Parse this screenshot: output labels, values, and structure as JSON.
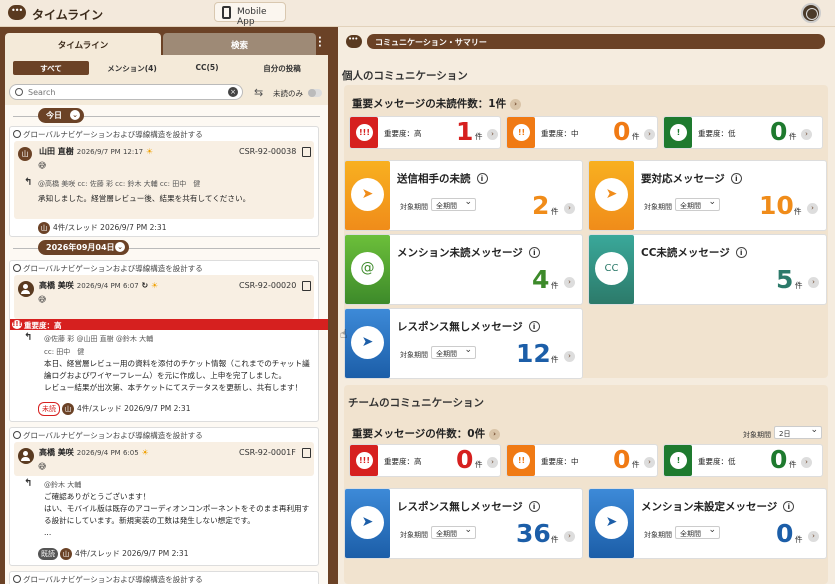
{
  "app": {
    "title": "タイムライン",
    "mobile_label": "Mobile App"
  },
  "left": {
    "tabs": [
      "タイムライン",
      "検索"
    ],
    "filters": [
      "すべて",
      "メンション(4)",
      "CC(5)",
      "自分の投稿"
    ],
    "search_placeholder": "Search",
    "unread_only": "未読のみ",
    "date1": "今日",
    "date2": "2026年09月04日",
    "threads": [
      {
        "title": "グローバルナビゲーションおよび導線構造を設計する",
        "sender": "山田 直樹",
        "avatar": "山",
        "time": "2026/9/7 PM 12:17",
        "code": "CSR-92-00038",
        "to": "@高橋 美咲  cc: 佐藤 彩  cc: 鈴木 大輔  cc: 田中　健",
        "body": "承知しました。経営層レビュー後、結果を共有してください。",
        "footer": "4件/スレッド 2026/9/7 PM 2:31"
      },
      {
        "title": "グローバルナビゲーションおよび導線構造を設計する",
        "sender": "高橋 美咲",
        "time": "2026/9/4 PM 6:07",
        "code": "CSR-92-00020",
        "priority": "重要度：高",
        "to": "@佐藤 彩  @山田 直樹  @鈴木 大輔",
        "cc": "cc: 田中　健",
        "body": "本日、経営層レビュー用の資料を添付のチケット情報（これまでのチャット議\n論ログおよびワイヤーフレーム）を元に作成し、上申を完了しました。\nレビュー結果が出次第、本チケットにてステータスを更新し、共有します！",
        "badge": "未読",
        "footer": "4件/スレッド 2026/9/7 PM 2:31"
      },
      {
        "title": "グローバルナビゲーションおよび導線構造を設計する",
        "sender": "高橋 美咲",
        "time": "2026/9/4 PM 6:05",
        "code": "CSR-92-0001F",
        "to": "@鈴木 大輔",
        "body": "ご確認ありがとうございます！\nはい、モバイル版は既存のアコーディオンコンポーネントをそのまま再利用す\nる設計にしています。新規実装の工数は発生しない想定です。\n...",
        "badge": "既読",
        "footer": "4件/スレッド 2026/9/7 PM 2:31"
      },
      {
        "title": "グローバルナビゲーションおよび導線構造を設計する"
      }
    ]
  },
  "right": {
    "header": "コミュニケーション・サマリー",
    "personal": {
      "title": "個人のコミュニケーション",
      "important_title": "重要メッセージの未読件数：1件",
      "prio": [
        {
          "label": "重要度：高",
          "value": "1",
          "color": "#d6201f",
          "icon": "!!!"
        },
        {
          "label": "重要度：中",
          "value": "0",
          "color": "#f07a14",
          "icon": "!!"
        },
        {
          "label": "重要度：低",
          "value": "0",
          "color": "#1e7a2e",
          "icon": "!"
        }
      ],
      "cards": [
        {
          "title": "送信相手の未読",
          "period_label": "対象期間",
          "period": "全期間",
          "value": "2",
          "color": "#f08c1a",
          "icon": "send-at-icon"
        },
        {
          "title": "要対応メッセージ",
          "period_label": "対象期間",
          "period": "全期間",
          "value": "10",
          "color": "#f08c1a",
          "icon": "send-at-icon"
        },
        {
          "title": "メンション未読メッセージ",
          "value": "4",
          "color": "#3d8a2a",
          "icon": "mention-icon"
        },
        {
          "title": "CC未読メッセージ",
          "value": "5",
          "color": "#2c7a6a",
          "icon": "cc-icon"
        },
        {
          "title": "レスポンス無しメッセージ",
          "period_label": "対象期間",
          "period": "全期間",
          "value": "12",
          "color": "#1c5ea8",
          "icon": "send-icon"
        }
      ]
    },
    "team": {
      "title": "チームのコミュニケーション",
      "important_title": "重要メッセージの件数：0件",
      "period_label": "対象期間",
      "period": "2日",
      "prio": [
        {
          "label": "重要度：高",
          "value": "0",
          "color": "#d6201f",
          "icon": "!!!"
        },
        {
          "label": "重要度：中",
          "value": "0",
          "color": "#f07a14",
          "icon": "!!"
        },
        {
          "label": "重要度：低",
          "value": "0",
          "color": "#1e7a2e",
          "icon": "!"
        }
      ],
      "cards": [
        {
          "title": "レスポンス無しメッセージ",
          "period_label": "対象期間",
          "period": "全期間",
          "value": "36",
          "color": "#1c5ea8",
          "icon": "send-icon"
        },
        {
          "title": "メンション未設定メッセージ",
          "period_label": "対象期間",
          "period": "全期間",
          "value": "0",
          "color": "#1c5ea8",
          "icon": "send-icon"
        }
      ]
    },
    "unit": "件"
  }
}
